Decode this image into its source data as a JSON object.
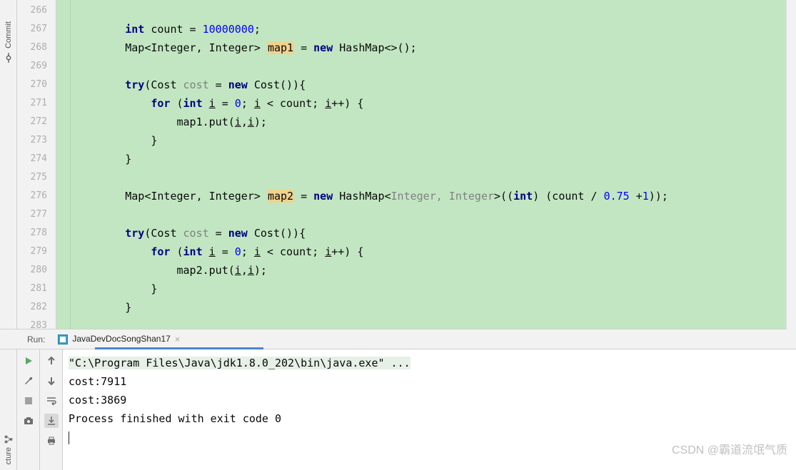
{
  "sidebar": {
    "commit_label": "Commit",
    "structure_label": "cture"
  },
  "editor": {
    "lines": [
      {
        "num": "266",
        "html": ""
      },
      {
        "num": "267",
        "html": "        <span class='k'>int</span> count = <span class='n'>10000000</span>;"
      },
      {
        "num": "268",
        "html": "        Map&lt;Integer, Integer&gt; <span class='hl'>map1</span> = <span class='k'>new</span> HashMap&lt;&gt;();"
      },
      {
        "num": "269",
        "html": ""
      },
      {
        "num": "270",
        "html": "        <span class='k'>try</span>(Cost <span class='g'>cost</span> = <span class='k'>new</span> Cost()){"
      },
      {
        "num": "271",
        "html": "            <span class='k'>for</span> (<span class='k'>int</span> <u>i</u> = <span class='n'>0</span>; <u>i</u> &lt; count; <u>i</u>++) {"
      },
      {
        "num": "272",
        "html": "                map1.put(<u>i</u>,<u>i</u>);"
      },
      {
        "num": "273",
        "html": "            }"
      },
      {
        "num": "274",
        "html": "        }"
      },
      {
        "num": "275",
        "html": ""
      },
      {
        "num": "276",
        "html": "        Map&lt;Integer, Integer&gt; <span class='hl'>map2</span> = <span class='k'>new</span> HashMap&lt;<span class='g'>Integer, Integer</span>&gt;((<span class='k'>int</span>) (count / <span class='n'>0.75</span> +<span class='n'>1</span>));"
      },
      {
        "num": "277",
        "html": ""
      },
      {
        "num": "278",
        "html": "        <span class='k'>try</span>(Cost <span class='g'>cost</span> = <span class='k'>new</span> Cost()){"
      },
      {
        "num": "279",
        "html": "            <span class='k'>for</span> (<span class='k'>int</span> <u>i</u> = <span class='n'>0</span>; <u>i</u> &lt; count; <u>i</u>++) {"
      },
      {
        "num": "280",
        "html": "                map2.put(<u>i</u>,<u>i</u>);"
      },
      {
        "num": "281",
        "html": "            }"
      },
      {
        "num": "282",
        "html": "        }"
      },
      {
        "num": "283",
        "html": ""
      }
    ]
  },
  "run": {
    "label": "Run:",
    "tab": "JavaDevDocSongShan17",
    "output": [
      {
        "cls": "cmd-hl",
        "text": "\"C:\\Program Files\\Java\\jdk1.8.0_202\\bin\\java.exe\" ..."
      },
      {
        "cls": "",
        "text": "cost:7911"
      },
      {
        "cls": "",
        "text": "cost:3869"
      },
      {
        "cls": "",
        "text": ""
      },
      {
        "cls": "",
        "text": "Process finished with exit code 0"
      }
    ]
  },
  "watermark": "CSDN @霸道流氓气质"
}
